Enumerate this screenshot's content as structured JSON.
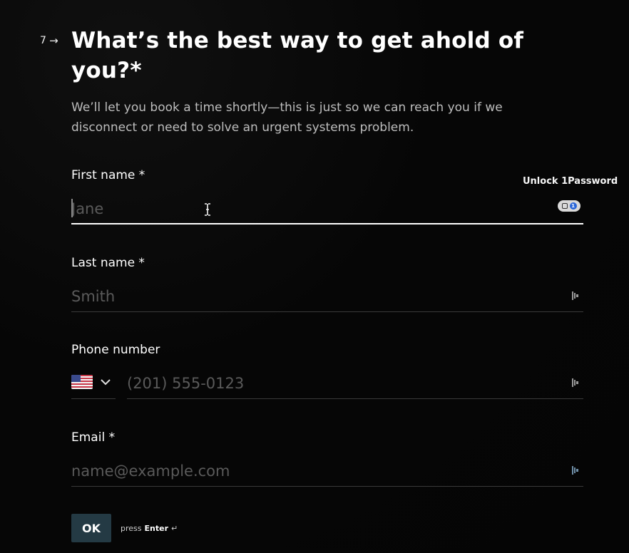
{
  "question": {
    "number": "7",
    "arrow": "→",
    "title": "What’s the best way to get ahold of you?*",
    "subtitle": "We’ll let you book a time shortly—this is just so we can reach you if we disconnect or need to solve an urgent systems problem."
  },
  "fields": {
    "first_name": {
      "label": "First name *",
      "value": "",
      "placeholder": "Jane"
    },
    "last_name": {
      "label": "Last name *",
      "value": "",
      "placeholder": "Smith"
    },
    "phone": {
      "label": "Phone number",
      "country_flag": "us-flag-icon",
      "value": "",
      "placeholder": "(201) 555-0123"
    },
    "email": {
      "label": "Email *",
      "value": "",
      "placeholder": "name@example.com"
    }
  },
  "password_manager": {
    "tooltip": "Unlock 1Password",
    "icon": "1password-icon",
    "badge_text": "1"
  },
  "actions": {
    "ok_label": "OK",
    "hint_prefix": "press",
    "hint_key": "Enter",
    "hint_symbol": "↵"
  },
  "colors": {
    "background": "#070707",
    "ok_button": "#243a44",
    "placeholder": "#5a5a5a",
    "accent_blue": "#2a66d8"
  }
}
